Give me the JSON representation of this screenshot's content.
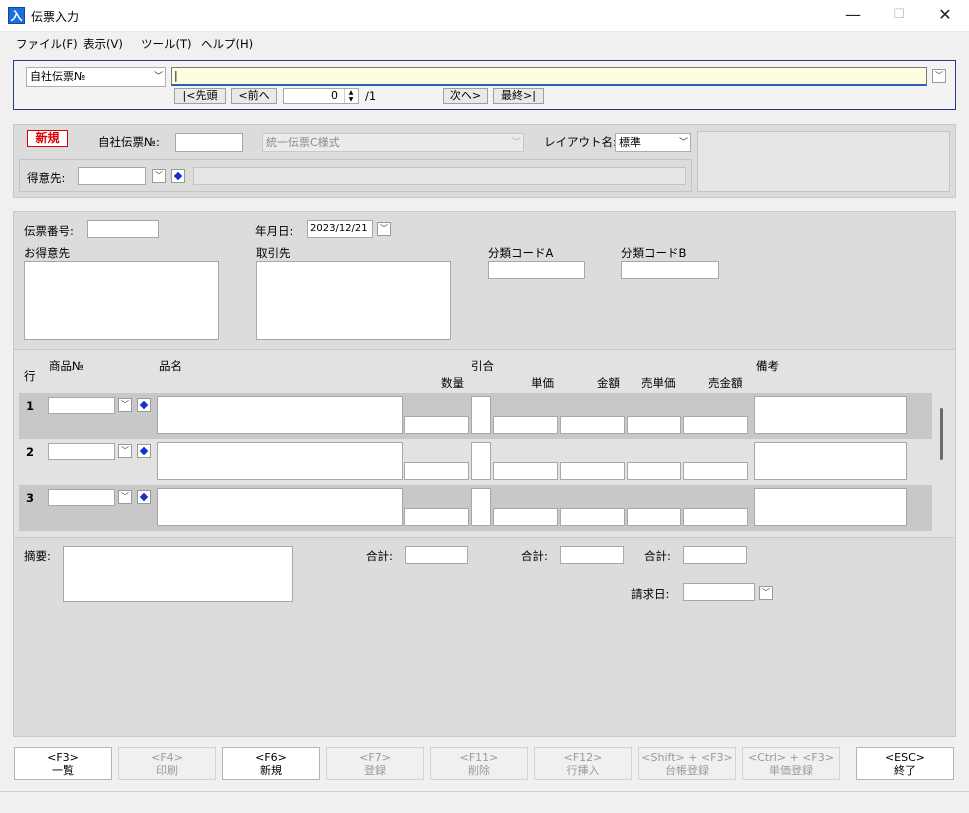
{
  "window": {
    "icon": "入",
    "title": "伝票入力",
    "minimize": "—",
    "maximize": "☐",
    "close": "✕"
  },
  "menu": [
    "ファイル(F)",
    "表示(V)",
    "ツール(T)",
    "ヘルプ(H)"
  ],
  "search": {
    "field_select": "自社伝票№",
    "value": "|",
    "first": "|<先頭",
    "prev": "<前へ",
    "page_value": "0",
    "page_total": "/1",
    "next": "次へ>",
    "last": "最終>|"
  },
  "header": {
    "status_badge": "新規",
    "doc_no_label": "自社伝票№:",
    "doc_no_value": "",
    "format_select": "統一伝票C様式",
    "layout_label": "レイアウト名:",
    "layout_value": "標準",
    "customer_label": "得意先:",
    "customer_code": "",
    "customer_name": ""
  },
  "slip": {
    "slip_no_label": "伝票番号:",
    "date_label": "年月日:",
    "date_value": "2023/12/21",
    "customer_label": "お得意先",
    "supplier_label": "取引先",
    "code_a_label": "分類コードA",
    "code_b_label": "分類コードB"
  },
  "grid": {
    "col_row": "行",
    "col_product_no": "商品№",
    "col_product_name": "品名",
    "col_hikiai": "引合",
    "col_qty": "数量",
    "col_unit_price": "単価",
    "col_amount": "金額",
    "col_sell_price": "売単価",
    "col_sell_amount": "売金額",
    "col_remarks": "備考",
    "rows": [
      "1",
      "2",
      "3"
    ]
  },
  "footer": {
    "memo_label": "摘要:",
    "total1_label": "合計:",
    "total2_label": "合計:",
    "total3_label": "合計:",
    "billing_date_label": "請求日:"
  },
  "fkeys": [
    {
      "key": "<F3>",
      "label": "一覧",
      "enabled": true
    },
    {
      "key": "<F4>",
      "label": "印刷",
      "enabled": false
    },
    {
      "key": "<F6>",
      "label": "新規",
      "enabled": true
    },
    {
      "key": "<F7>",
      "label": "登録",
      "enabled": false
    },
    {
      "key": "<F11>",
      "label": "削除",
      "enabled": false
    },
    {
      "key": "<F12>",
      "label": "行挿入",
      "enabled": false
    },
    {
      "key": "<Shift> + <F3>",
      "label": "台帳登録",
      "enabled": false
    },
    {
      "key": "<Ctrl> + <F3>",
      "label": "単価登録",
      "enabled": false
    },
    {
      "key": "<ESC>",
      "label": "終了",
      "enabled": true
    }
  ],
  "colors": {
    "accent": "#2a3a8a",
    "badge": "#dd0000",
    "input_highlight": "#fffde0"
  }
}
